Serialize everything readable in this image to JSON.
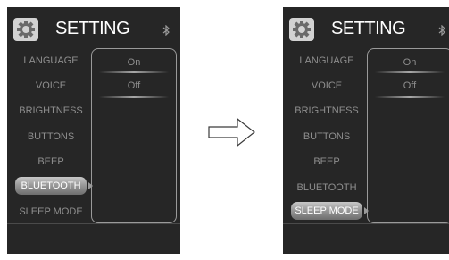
{
  "header": {
    "title": "SETTING",
    "settings_icon": "gear-icon",
    "status_icon": "bluetooth-icon"
  },
  "menu_items": [
    "LANGUAGE",
    "VOICE",
    "BRIGHTNESS",
    "BUTTONS",
    "BEEP",
    "BLUETOOTH",
    "SLEEP MODE"
  ],
  "options": [
    "On",
    "Off"
  ],
  "screens": [
    {
      "state": "before",
      "selected_item": "BLUETOOTH"
    },
    {
      "state": "after",
      "selected_item": "SLEEP MODE"
    }
  ],
  "transition_icon": "right-arrow-icon",
  "colors": {
    "screen_bg": "#262626",
    "menu_text": "#8e8e8e",
    "highlight": "#a8a8a8"
  }
}
